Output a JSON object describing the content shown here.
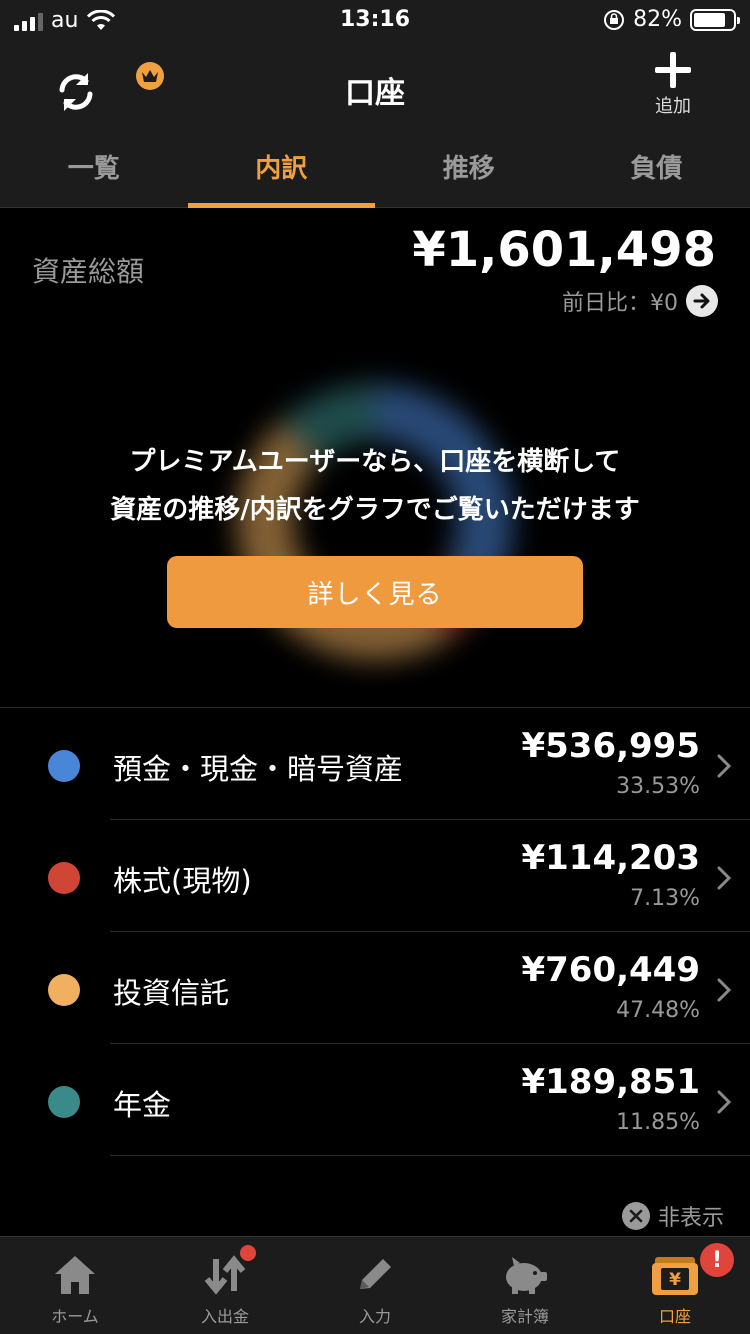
{
  "status_bar": {
    "carrier": "au",
    "time": "13:16",
    "battery": "82%",
    "battery_level": 0.82
  },
  "header": {
    "title": "口座",
    "add_label": "追加"
  },
  "tabs": [
    {
      "label": "一覧",
      "active": false
    },
    {
      "label": "内訳",
      "active": true
    },
    {
      "label": "推移",
      "active": false
    },
    {
      "label": "負債",
      "active": false
    }
  ],
  "summary": {
    "label": "資産総額",
    "amount": "¥1,601,498",
    "diff": "前日比：¥0"
  },
  "promo": {
    "line1": "プレミアムユーザーなら、口座を横断して",
    "line2": "資産の推移/内訳をグラフでご覧いただけます",
    "button": "詳しく見る"
  },
  "chart_data": {
    "type": "pie",
    "categories": [
      "預金・現金・暗号資産",
      "株式(現物)",
      "投資信託",
      "年金"
    ],
    "values": [
      536995,
      114203,
      760449,
      189851
    ],
    "percents": [
      33.53,
      7.13,
      47.48,
      11.85
    ],
    "colors": [
      "#4a86d8",
      "#d04636",
      "#f0b060",
      "#3a8a8a"
    ]
  },
  "assets": [
    {
      "label": "預金・現金・暗号資産",
      "amount": "¥536,995",
      "percent": "33.53%",
      "color": "#4a86d8"
    },
    {
      "label": "株式(現物)",
      "amount": "¥114,203",
      "percent": "7.13%",
      "color": "#d04636"
    },
    {
      "label": "投資信託",
      "amount": "¥760,449",
      "percent": "47.48%",
      "color": "#f0b060"
    },
    {
      "label": "年金",
      "amount": "¥189,851",
      "percent": "11.85%",
      "color": "#3a8a8a"
    }
  ],
  "hide_label": "非表示",
  "bottom_nav": [
    {
      "label": "ホーム",
      "icon": "home-icon"
    },
    {
      "label": "入出金",
      "icon": "transfer-icon"
    },
    {
      "label": "入力",
      "icon": "pencil-icon"
    },
    {
      "label": "家計簿",
      "icon": "piggy-bank-icon"
    },
    {
      "label": "口座",
      "icon": "wallet-yen-icon",
      "active": true
    }
  ],
  "alert_badge": "!"
}
